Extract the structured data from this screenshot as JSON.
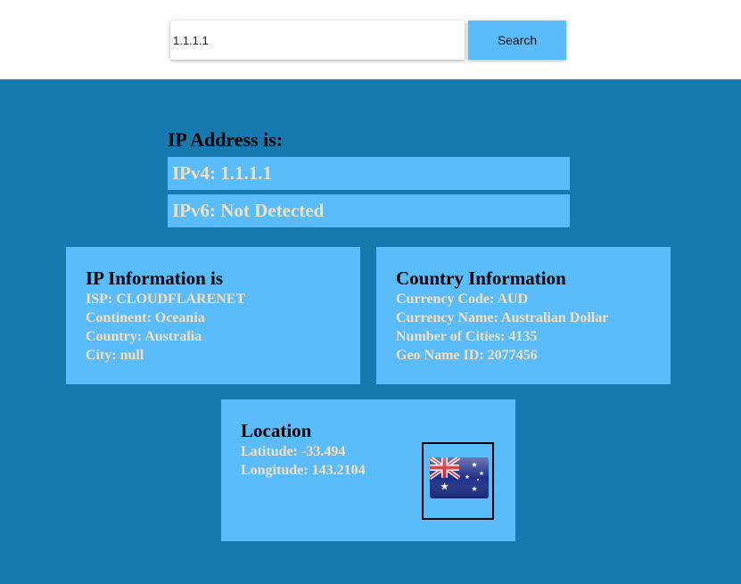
{
  "search": {
    "value": "1.1.1.1",
    "button_label": "Search"
  },
  "ip_address": {
    "heading": "IP Address is:",
    "ipv4": "IPv4: 1.1.1.1",
    "ipv6": "IPv6: Not Detected"
  },
  "ip_information": {
    "title": "IP Information is",
    "lines": [
      "ISP: CLOUDFLARENET",
      "Continent: Oceania",
      "Country: Australia",
      "City: null"
    ]
  },
  "country_information": {
    "title": "Country Information",
    "lines": [
      "Currency Code: AUD",
      "Currency Name: Australian Dollar",
      "Number of Cities: 4135",
      "Geo Name ID: 2077456"
    ]
  },
  "location": {
    "title": "Location",
    "latitude": "Latitude: -33.494",
    "longitude": "Longitude: 143.2104",
    "flag_icon": "australia-flag-icon"
  },
  "colors": {
    "background": "#177aae",
    "panel": "#5bbcfc",
    "value_text": "#f5dfb9"
  }
}
